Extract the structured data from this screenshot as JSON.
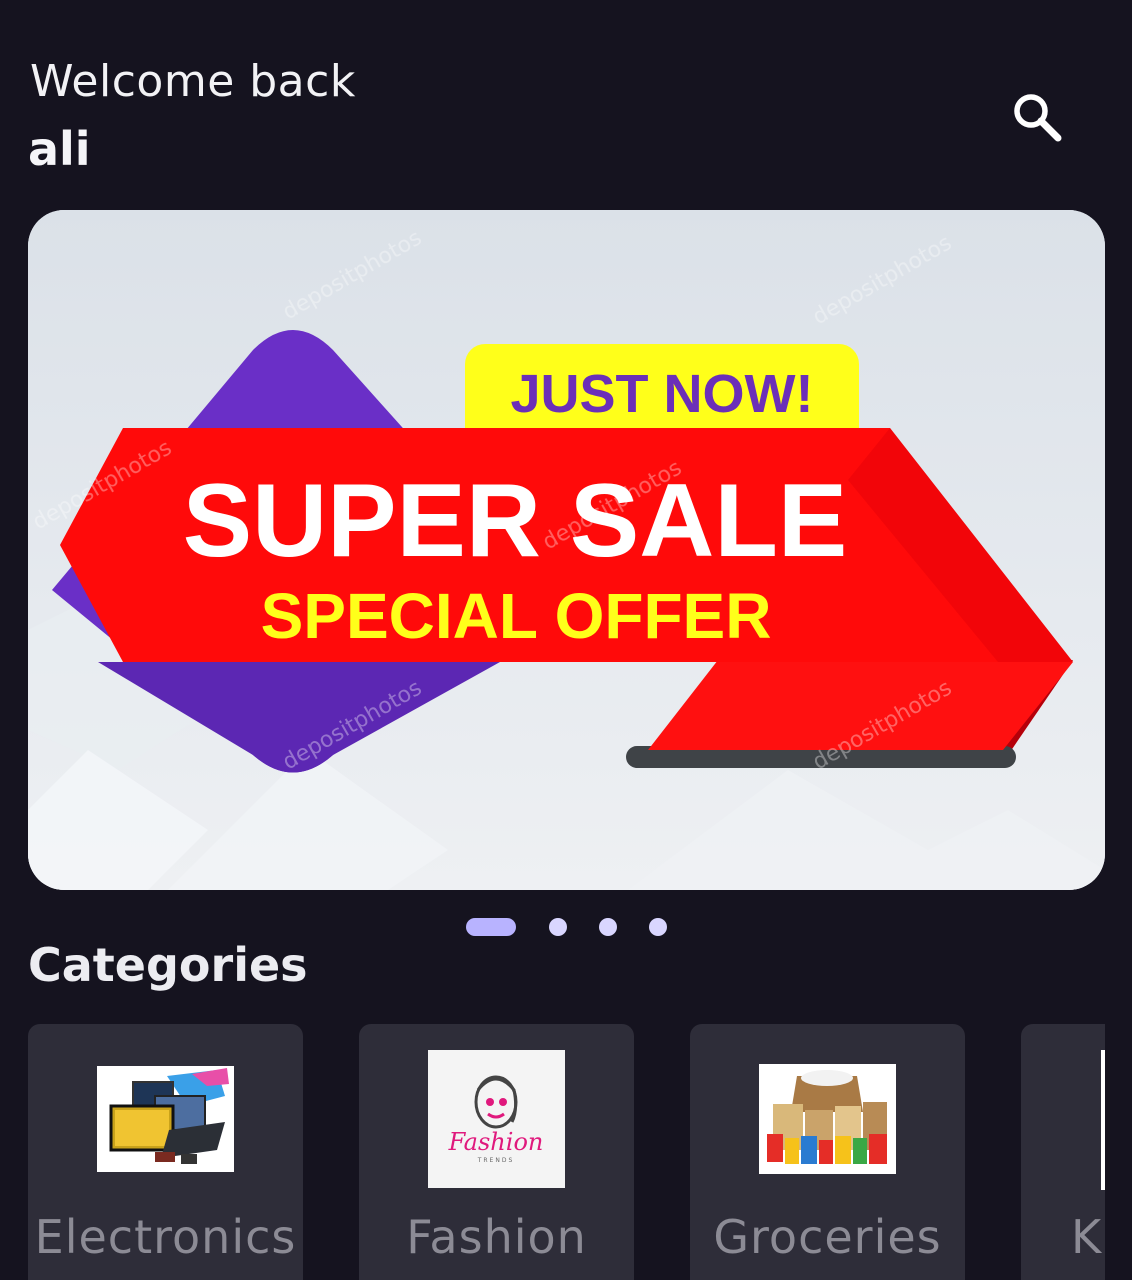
{
  "header": {
    "greeting": "Welcome back",
    "username": "ali"
  },
  "search": {
    "icon": "search-icon"
  },
  "banner": {
    "top_tag": "JUST NOW!",
    "headline": "SUPER SALE",
    "subline": "SPECIAL OFFER",
    "watermark": "depositphotos",
    "colors": {
      "ribbon": "#ff0a0a",
      "diamond": "#6a2fc7",
      "tag": "#ffff1a",
      "tag_text": "#6b2fb8",
      "subline_text": "#ffff1a"
    }
  },
  "carousel": {
    "active_index": 0,
    "count": 4
  },
  "categories": {
    "title": "Categories",
    "items": [
      {
        "label": "Electronics",
        "thumb": "electronics-image"
      },
      {
        "label": "Fashion",
        "thumb": "fashion-logo-image",
        "logo_text": "Fashion",
        "logo_sub": "TRENDS"
      },
      {
        "label": "Groceries",
        "thumb": "groceries-image"
      },
      {
        "label": "Ki",
        "thumb": "partial-image"
      }
    ]
  }
}
